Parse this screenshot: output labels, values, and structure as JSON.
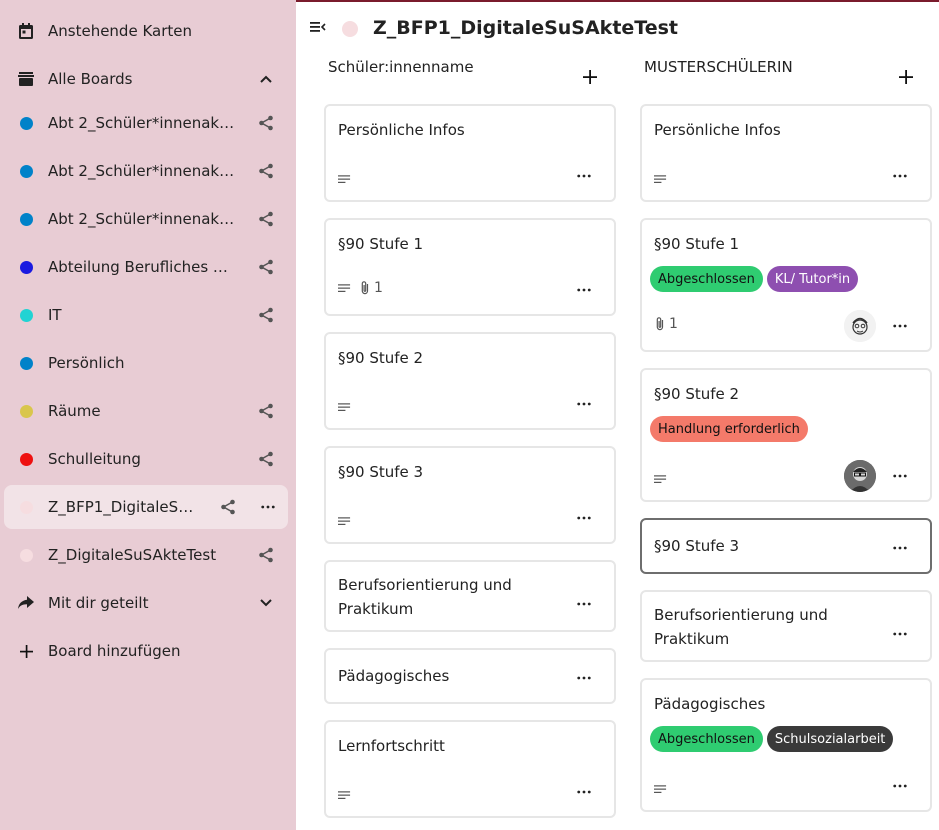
{
  "sidebar": {
    "items": [
      {
        "label": "Anstehende Karten",
        "icon": "calendar-icon"
      },
      {
        "label": "Alle Boards",
        "icon": "archive-icon"
      },
      {
        "label": "Abt 2_Schüler*innenakte…",
        "color": "#0082c9"
      },
      {
        "label": "Abt 2_Schüler*innenakte…",
        "color": "#0082c9"
      },
      {
        "label": "Abt 2_Schüler*innenakte…",
        "color": "#0082c9"
      },
      {
        "label": "Abteilung Berufliches Gy…",
        "color": "#1a1ae0"
      },
      {
        "label": "IT",
        "color": "#22d3d3"
      },
      {
        "label": "Persönlich",
        "color": "#0082c9"
      },
      {
        "label": "Räume",
        "color": "#d9c64c"
      },
      {
        "label": "Schulleitung",
        "color": "#ee1010"
      },
      {
        "label": "Z_BFP1_DigitaleSuS…",
        "color": "#f6dde0"
      },
      {
        "label": "Z_DigitaleSuSAkteTest",
        "color": "#f6dde0"
      },
      {
        "label": "Mit dir geteilt",
        "icon": "share-arrow-icon"
      },
      {
        "label": "Board hinzufügen",
        "icon": "plus-icon"
      }
    ]
  },
  "header": {
    "title": "Z_BFP1_DigitaleSuSAkteTest"
  },
  "stacks": [
    {
      "title": "Schüler:innenname",
      "cards": [
        {
          "title": "Persönliche Infos"
        },
        {
          "title": "§90 Stufe 1",
          "attachments": "1"
        },
        {
          "title": "§90 Stufe 2"
        },
        {
          "title": "§90 Stufe 3"
        },
        {
          "title": "Berufsorientierung und Praktikum"
        },
        {
          "title": "Pädagogisches"
        },
        {
          "title": "Lernfortschritt"
        }
      ]
    },
    {
      "title": "MUSTERSCHÜLERIN",
      "cards": [
        {
          "title": "Persönliche Infos"
        },
        {
          "title": "§90 Stufe 1",
          "attachments": "1",
          "labels": [
            {
              "text": "Abgeschlossen",
              "bg": "#2fcc71",
              "fg": "#111"
            },
            {
              "text": "KL/ Tutor*in",
              "bg": "#8e4fb0",
              "fg": "#fff"
            }
          ]
        },
        {
          "title": "§90 Stufe 2",
          "labels": [
            {
              "text": "Handlung erforderlich",
              "bg": "#f47a6a",
              "fg": "#111"
            }
          ]
        },
        {
          "title": "§90 Stufe 3"
        },
        {
          "title": "Berufsorientierung und Praktikum"
        },
        {
          "title": "Pädagogisches",
          "labels": [
            {
              "text": "Abgeschlossen",
              "bg": "#2fcc71",
              "fg": "#111"
            },
            {
              "text": "Schulsozialarbeit",
              "bg": "#3a3a3a",
              "fg": "#fff"
            }
          ]
        }
      ]
    }
  ]
}
